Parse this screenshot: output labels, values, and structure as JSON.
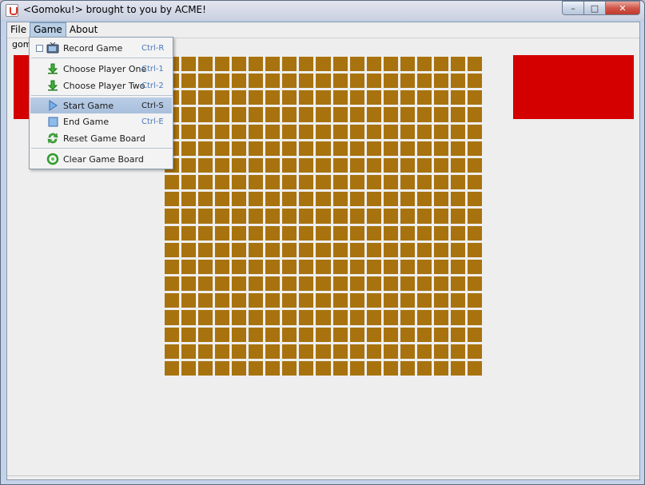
{
  "window": {
    "title": "<Gomoku!> brought to you by ACME!",
    "controls": {
      "minimize": "–",
      "maximize": "□",
      "close": "✕"
    }
  },
  "menubar": {
    "items": [
      {
        "label": "File"
      },
      {
        "label": "Game"
      },
      {
        "label": "About"
      }
    ]
  },
  "pane": {
    "label": "gomo"
  },
  "game_menu": {
    "items": [
      {
        "label": "Record Game",
        "accel": "Ctrl-R",
        "icon": "tv-icon",
        "checkbox": true
      },
      {
        "label": "Choose Player One",
        "accel": "Ctrl-1",
        "icon": "download-arrow-icon"
      },
      {
        "label": "Choose Player Two",
        "accel": "Ctrl-2",
        "icon": "download-arrow-icon"
      },
      {
        "label": "Start Game",
        "accel": "Ctrl-S",
        "icon": "play-icon",
        "selected": true
      },
      {
        "label": "End Game",
        "accel": "Ctrl-E",
        "icon": "stop-square-icon"
      },
      {
        "label": "Reset Game Board",
        "accel": "",
        "icon": "refresh-icon"
      },
      {
        "label": "Clear Game Board",
        "accel": "",
        "icon": "clear-icon"
      }
    ]
  },
  "board": {
    "rows": 19,
    "cols": 19,
    "cell_color": "#a8730e"
  },
  "colors": {
    "player_panel": "#d40000",
    "menu_highlight": "#b9cde6",
    "accelerator_text": "#4a78b8"
  }
}
